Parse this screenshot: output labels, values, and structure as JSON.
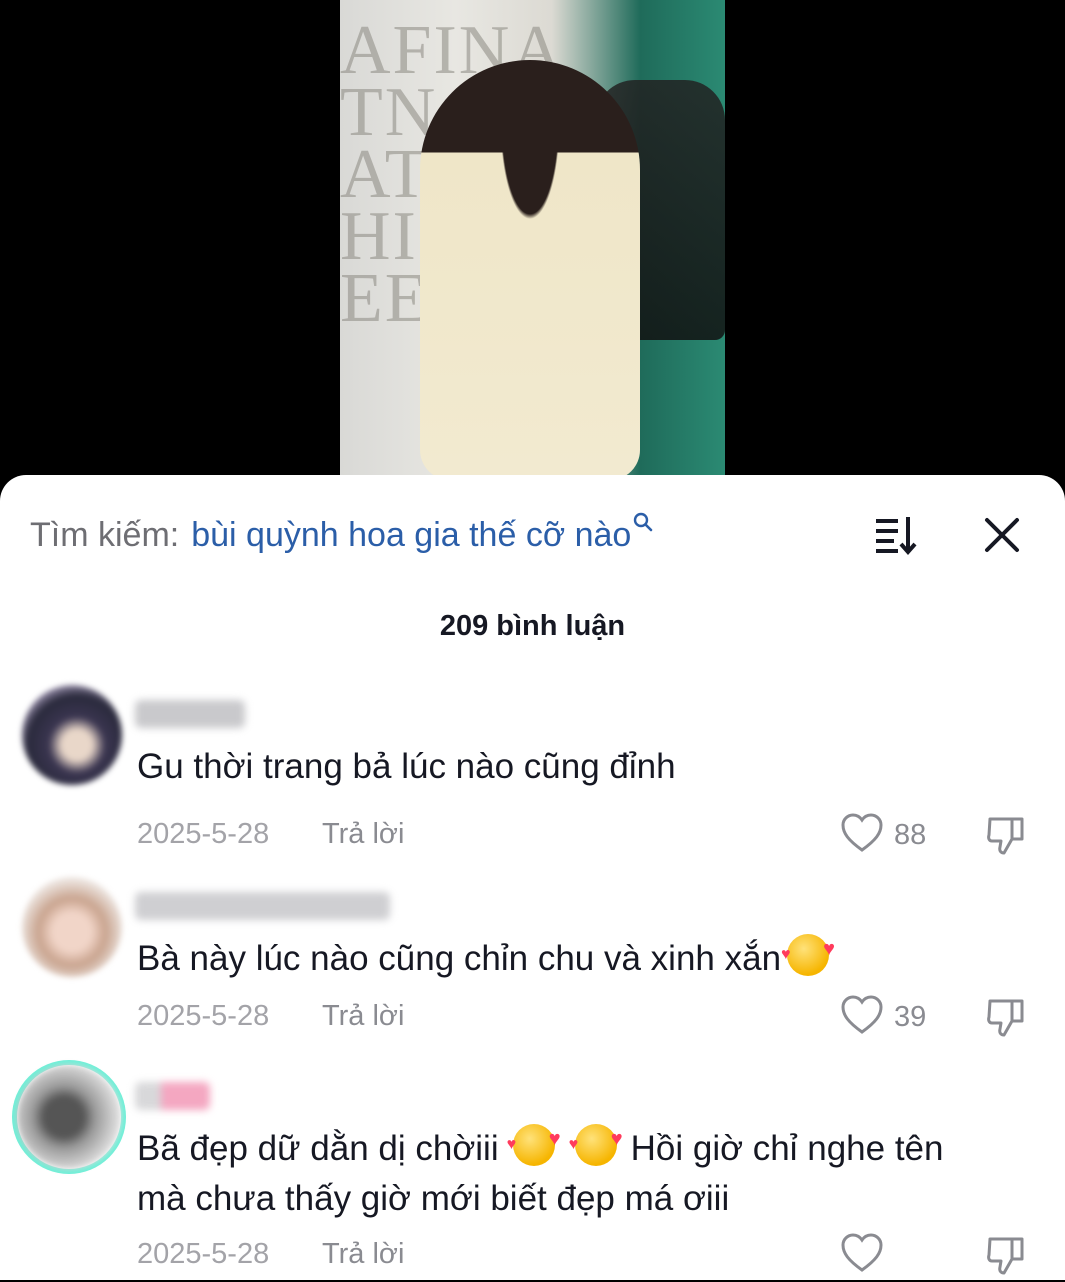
{
  "header": {
    "search_prefix": "Tìm kiếm:",
    "search_query": "bùi quỳnh hoa gia thế cỡ nào",
    "sort_icon": "sort-icon",
    "close_icon": "close-icon"
  },
  "comments_count": "209 bình luận",
  "comments": [
    {
      "text": "Gu thời trang bả lúc nào cũng đỉnh",
      "date": "2025-5-28",
      "reply": "Trả lời",
      "likes": "88"
    },
    {
      "text": "Bà này lúc nào cũng chỉn chu và xinh xắn",
      "emoji": "smiling-face-with-hearts",
      "date": "2025-5-28",
      "reply": "Trả lời",
      "likes": "39"
    },
    {
      "text_part1": "Bã đẹp dữ dằn dị chờiii",
      "text_part2": "Hồi giờ chỉ nghe tên",
      "text_line2": "mà chưa thấy giờ mới biết đẹp má ơiii",
      "date": "2025-5-28",
      "reply": "Trả lời",
      "likes": ""
    }
  ],
  "video_wall_text": "AFINA TNA NATIO HIC EE",
  "colors": {
    "link_blue": "#2b5ea8",
    "muted_gray": "#8a8b91",
    "avatar_ring": "#6ff0d8"
  }
}
